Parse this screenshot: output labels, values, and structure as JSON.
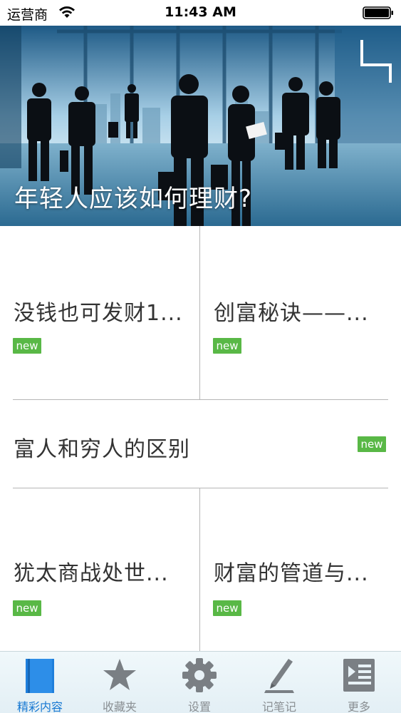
{
  "status_bar": {
    "carrier": "运营商",
    "time": "11:43 AM"
  },
  "hero": {
    "title": "年轻人应该如何理财?"
  },
  "articles": [
    {
      "title": "没钱也可发财1...",
      "badge": "new"
    },
    {
      "title": "创富秘诀——...",
      "badge": "new"
    },
    {
      "title": "富人和穷人的区别",
      "badge": "new"
    },
    {
      "title": "犹太商战处世...",
      "badge": "new"
    },
    {
      "title": "财富的管道与...",
      "badge": "new"
    }
  ],
  "tabbar": {
    "items": [
      {
        "label": "精彩内容",
        "icon": "book-icon",
        "active": true
      },
      {
        "label": "收藏夹",
        "icon": "star-icon",
        "active": false
      },
      {
        "label": "设置",
        "icon": "gear-icon",
        "active": false
      },
      {
        "label": "记笔记",
        "icon": "pen-icon",
        "active": false
      },
      {
        "label": "更多",
        "icon": "more-list-icon",
        "active": false
      }
    ]
  },
  "colors": {
    "badge_green": "#59b846",
    "tab_active": "#1778d2",
    "tab_inactive": "#8a8f93"
  }
}
